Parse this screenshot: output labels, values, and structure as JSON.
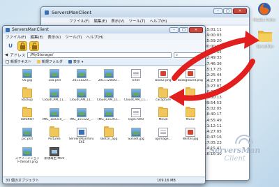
{
  "desktop": {
    "browser_icon_label": "Mozilla Firefox",
    "folder_icon_label": "ServerMan"
  },
  "back_window": {
    "title": "ServersManClient",
    "menu": [
      "ファイル(F)",
      "編集(E)",
      "表示(V)",
      "ツール(T)",
      "ヘルプ(H)"
    ],
    "timestamps": [
      "15:01:11",
      "19:00:03",
      "15:59:20",
      "00:00:15",
      "15:25:55",
      "12:49:33",
      "17:46:36",
      "15:17:25",
      "12:25:44",
      "14:27:07",
      "13:27:07",
      "16:39:37",
      "13:30:13",
      "09:54:53",
      "15:02:05",
      "16:40:17",
      "14:55:49",
      "11:12:11",
      "14:27:05",
      "10:47:16",
      "17:05:23",
      "14:15:41",
      "16:16:30"
    ]
  },
  "front_window": {
    "title": "ServersManClient",
    "menu": [
      "ファイル(F)",
      "編集(E)",
      "表示(V)",
      "ツール(T)",
      "ヘルプ(H)"
    ],
    "address_label": "アドレス",
    "address_value": "/MyStorage/",
    "commands": {
      "new_text": "新規テキスト",
      "new_folder": "新規フォルダ",
      "view": "表示"
    },
    "files": [
      {
        "name": "05.jpg",
        "kind": "image"
      },
      {
        "name": "15a.psd",
        "kind": "image"
      },
      {
        "name": "20111120...",
        "kind": "image"
      },
      {
        "name": "20111205l0...",
        "kind": "image"
      },
      {
        "name": "b.txt",
        "kind": "doc"
      },
      {
        "name": "back2.png",
        "kind": "archive"
      },
      {
        "name": "background.png",
        "kind": "archive"
      },
      {
        "name": "Backup",
        "kind": "folder"
      },
      {
        "name": "CloudCAM_11...",
        "kind": "image"
      },
      {
        "name": "CloudCAM_11...",
        "kind": "image"
      },
      {
        "name": "CloudCAM_11...",
        "kind": "image"
      },
      {
        "name": "CloudCAM_11...",
        "kind": "image"
      },
      {
        "name": "cacapture",
        "kind": "folder"
      },
      {
        "name": "Docu...",
        "kind": "folder"
      },
      {
        "name": "dofaftlef",
        "kind": "folder"
      },
      {
        "name": "IMG_110314_...",
        "kind": "image"
      },
      {
        "name": "IMG_111122_...",
        "kind": "image"
      },
      {
        "name": "IMG_111203...",
        "kind": "image"
      },
      {
        "name": "login.html",
        "kind": "doc"
      },
      {
        "name": "Movie",
        "kind": "folder"
      },
      {
        "name": "Music",
        "kind": "folder"
      },
      {
        "name": "pic.psd",
        "kind": "image"
      },
      {
        "name": "Pictures",
        "kind": "folder"
      },
      {
        "name": "ServersManmini.EXE",
        "kind": "exe"
      },
      {
        "name": "sketch_app",
        "kind": "folder"
      },
      {
        "name": "Sunset.jpg",
        "kind": "image"
      },
      {
        "name": "upimage...",
        "kind": "doc"
      },
      {
        "name": "Winter.jpg",
        "kind": "archive"
      },
      {
        "name": "スクリーンショット(Small).png",
        "kind": "image"
      },
      {
        "name": "新規再生.MOV",
        "kind": "video"
      }
    ],
    "status_count": "30 個のオブジェクト",
    "status_size": "109.16 MB"
  },
  "watermark": {
    "main": "ServersMan",
    "sub": "Client"
  },
  "colors": {
    "arrow": "#e11f1f",
    "folder": "#f1c75d",
    "accent": "#3b6fb5"
  }
}
